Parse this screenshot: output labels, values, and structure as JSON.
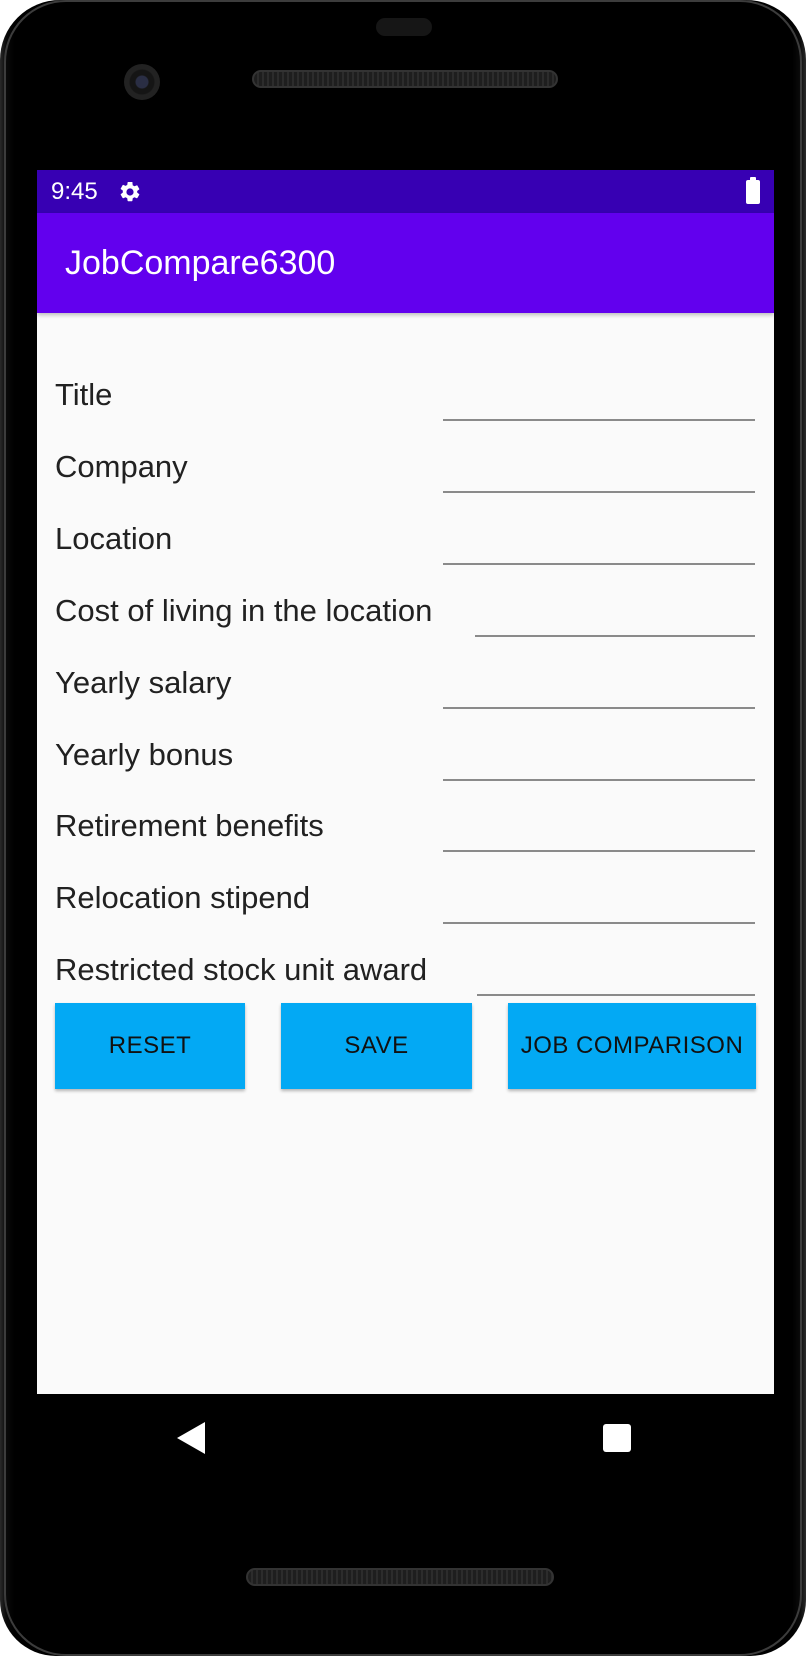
{
  "status_bar": {
    "time": "9:45",
    "icons": [
      "gear-icon",
      "battery-icon"
    ]
  },
  "app_bar": {
    "title": "JobCompare6300"
  },
  "form": {
    "fields": [
      {
        "label": "Title",
        "value": ""
      },
      {
        "label": "Company",
        "value": ""
      },
      {
        "label": "Location",
        "value": ""
      },
      {
        "label": "Cost of living in the location",
        "value": ""
      },
      {
        "label": "Yearly salary",
        "value": ""
      },
      {
        "label": "Yearly bonus",
        "value": ""
      },
      {
        "label": "Retirement benefits",
        "value": ""
      },
      {
        "label": "Relocation stipend",
        "value": ""
      },
      {
        "label": "Restricted stock unit award",
        "value": ""
      }
    ]
  },
  "buttons": {
    "reset": "RESET",
    "save": "SAVE",
    "job_comparison": "JOB COMPARISON"
  },
  "nav_bar": {
    "icons": [
      "back-icon",
      "recents-icon"
    ]
  },
  "colors": {
    "status_bar": "#3700b3",
    "app_bar": "#6200ee",
    "button": "#03a9f4",
    "background": "#fafafa"
  }
}
